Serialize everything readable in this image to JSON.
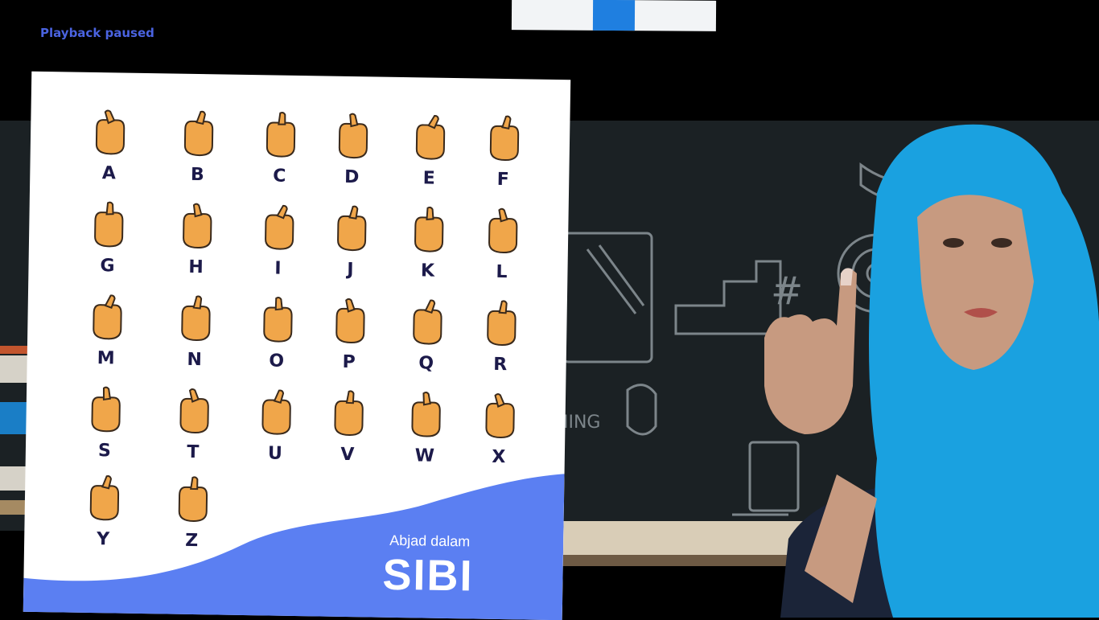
{
  "player": {
    "status_text": "Playback paused",
    "progress_bar": {
      "track_color": "#f2f4f6",
      "fill_color": "#1f7fe0"
    }
  },
  "card": {
    "title_small": "Abjad dalam",
    "title_big": "SIBI",
    "letters": [
      "A",
      "B",
      "C",
      "D",
      "E",
      "F",
      "G",
      "H",
      "I",
      "J",
      "K",
      "L",
      "M",
      "N",
      "O",
      "P",
      "Q",
      "R",
      "S",
      "T",
      "U",
      "V",
      "W",
      "X",
      "Y",
      "Z"
    ],
    "colors": {
      "hand": "#f0a64a",
      "outline": "#3a2a1c",
      "wave": "#5b7ff2",
      "letter": "#1c1a4a"
    }
  },
  "background": {
    "board_color": "#1b2124",
    "board_doodle_text": "NING"
  }
}
